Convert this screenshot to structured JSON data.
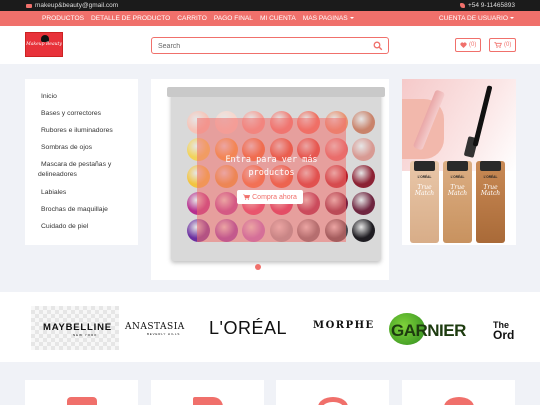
{
  "topbar": {
    "email": "makeup&beauty@gmail.com",
    "phone": "+54 9-11465893"
  },
  "nav": {
    "links": [
      "PRODUCTOS",
      "DETALLE DE PRODUCTO",
      "CARRITO",
      "PAGO FINAL",
      "MI CUENTA",
      "MAS PAGINAS"
    ],
    "user_menu": "CUENTA DE USUARIO"
  },
  "header": {
    "logo_text": "Makeup Beauty",
    "search_placeholder": "Search",
    "wishlist_count": "(0)",
    "cart_count": "(0)"
  },
  "sidebar": {
    "items": [
      "Inicio",
      "Bases y correctores",
      "Rubores e iluminadores",
      "Sombras de ojos",
      "Mascara de pestañas y",
      "delineadores",
      "Labiales",
      "Brochas de maquillaje",
      "Cuidado de piel"
    ]
  },
  "carousel": {
    "overlay_line1": "Entra para ver más",
    "overlay_line2": "productos",
    "buy_button": "Compra ahora",
    "palette_colors": [
      "#f6c4b8",
      "#f8d6cc",
      "#f4a097",
      "#f07d75",
      "#ef6f5f",
      "#e8906f",
      "#c9836b",
      "#f2d35a",
      "#f6a23b",
      "#ef6a2e",
      "#e24b2e",
      "#d93b2f",
      "#e26b6b",
      "#d89a93",
      "#f2c440",
      "#e9a23b",
      "#f3743a",
      "#e9542e",
      "#cf2d2d",
      "#b7202c",
      "#8c2234",
      "#b62e8e",
      "#b23fa2",
      "#e0356f",
      "#d4245e",
      "#9d1f4b",
      "#7a1f3e",
      "#6f2640",
      "#6b2fa0",
      "#8d3fb5",
      "#b36fcf",
      "#9aa1a6",
      "#6f6d73",
      "#4a474e",
      "#1f1d22"
    ],
    "pan_labels": "none"
  },
  "promo": {
    "brand_label": "L'ORÉAL",
    "product_name": "True Match"
  },
  "brands": {
    "maybelline": "MAYBELLINE",
    "maybelline_sub": "NEW YORK",
    "anastasia": "ANASTASIA",
    "anastasia_sub": "BEVERLY HILLS",
    "loreal": "L'ORÉAL",
    "morphe": "MORPHE",
    "garnier": "GARNIER",
    "ordinary_line1": "The",
    "ordinary_line2": "Ord"
  },
  "colors": {
    "accent": "#f0706b",
    "topbar": "#1b1b1b",
    "page_bg": "#f0f2f7"
  },
  "icons": [
    "envelope-icon",
    "phone-icon",
    "search-icon",
    "heart-icon",
    "cart-icon"
  ]
}
